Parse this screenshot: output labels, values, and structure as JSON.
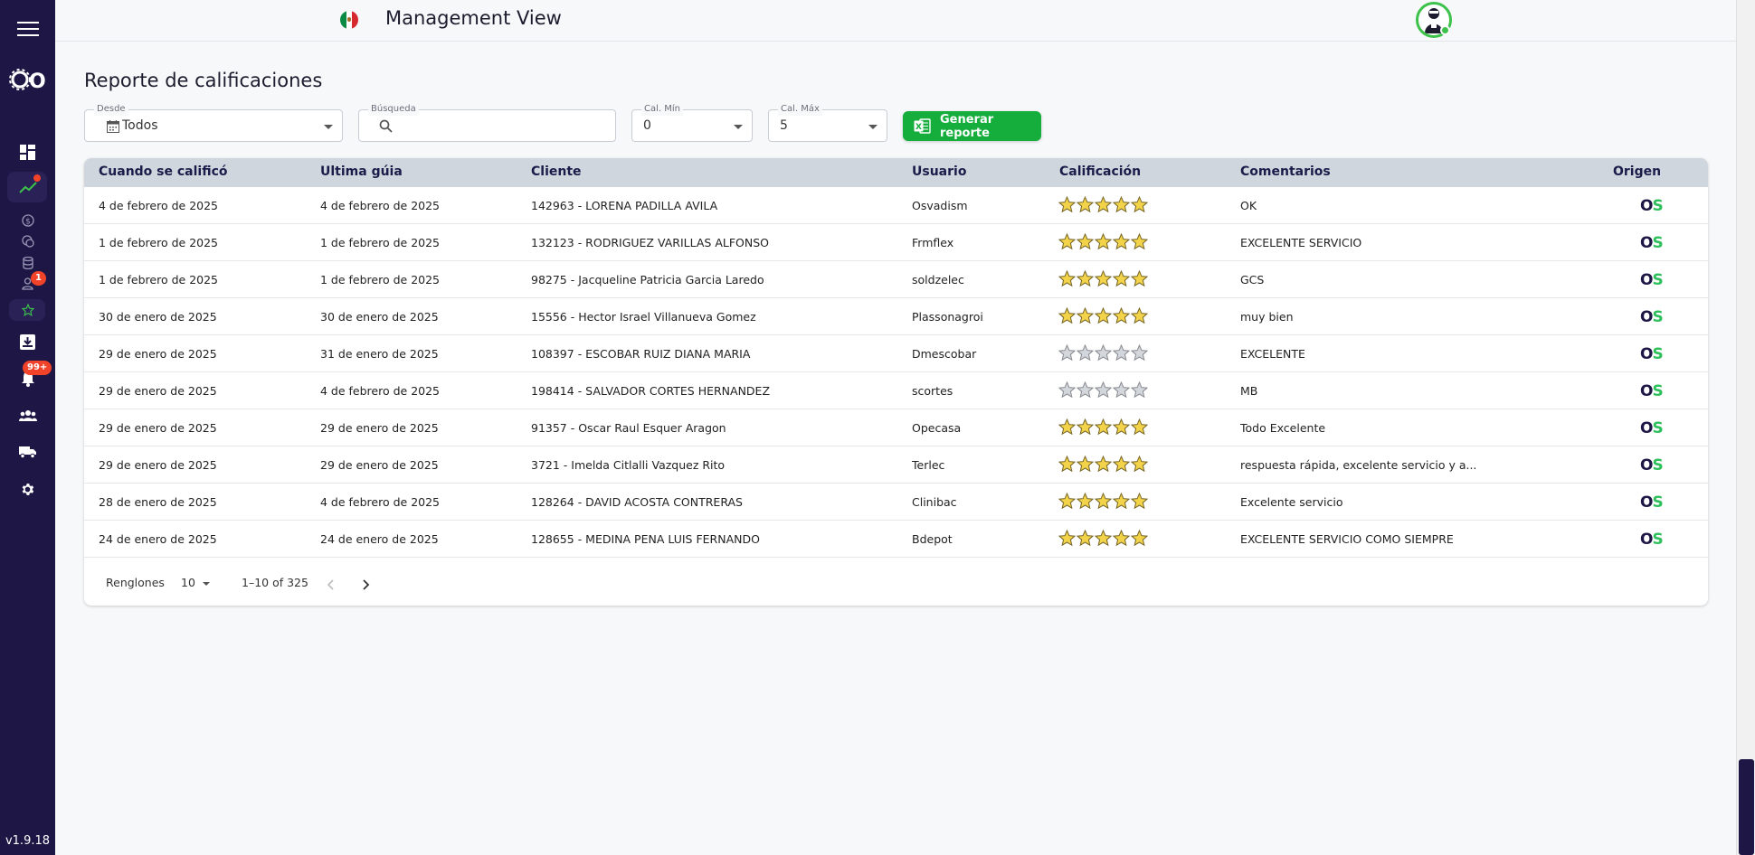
{
  "app": {
    "header_title": "Management View",
    "version": "v1.9.18",
    "logo_text": "OS",
    "flag": "mexico-flag",
    "sidebar": {
      "trend_badge": "dot",
      "user_badge": "1",
      "notif_badge": "99+"
    }
  },
  "page": {
    "title": "Reporte de calificaciones",
    "filters": {
      "desde_label": "Desde",
      "desde_value": "Todos",
      "busqueda_label": "Búsqueda",
      "busqueda_value": "",
      "calmin_label": "Cal. Mín",
      "calmin_value": "0",
      "calmax_label": "Cal. Máx",
      "calmax_value": "5"
    },
    "generate_button": "Generar reporte"
  },
  "table": {
    "headers": {
      "fecha": "Cuando se calificó",
      "guia": "Ultima gúia",
      "cliente": "Cliente",
      "usuario": "Usuario",
      "calificacion": "Calificación",
      "comentarios": "Comentarios",
      "origen": "Origen"
    },
    "rows": [
      {
        "fecha": "4 de febrero de 2025",
        "guia": "4 de febrero de 2025",
        "cliente": "142963 - LORENA PADILLA AVILA",
        "usuario": "Osvadism",
        "rating": 5,
        "comentario": "OK",
        "origen": "OS"
      },
      {
        "fecha": "1 de febrero de 2025",
        "guia": "1 de febrero de 2025",
        "cliente": "132123 - RODRIGUEZ VARILLAS ALFONSO",
        "usuario": "Frmflex",
        "rating": 5,
        "comentario": "EXCELENTE SERVICIO",
        "origen": "OS"
      },
      {
        "fecha": "1 de febrero de 2025",
        "guia": "1 de febrero de 2025",
        "cliente": "98275 - Jacqueline Patricia Garcia Laredo",
        "usuario": "soldzelec",
        "rating": 5,
        "comentario": "GCS",
        "origen": "OS"
      },
      {
        "fecha": "30 de enero de 2025",
        "guia": "30 de enero de 2025",
        "cliente": "15556 - Hector Israel Villanueva Gomez",
        "usuario": "Plassonagroi",
        "rating": 5,
        "comentario": "muy bien",
        "origen": "OS"
      },
      {
        "fecha": "29 de enero de 2025",
        "guia": "31 de enero de 2025",
        "cliente": "108397 - ESCOBAR RUIZ DIANA MARIA",
        "usuario": "Dmescobar",
        "rating": 0,
        "comentario": "EXCELENTE",
        "origen": "OS"
      },
      {
        "fecha": "29 de enero de 2025",
        "guia": "4 de febrero de 2025",
        "cliente": "198414 - SALVADOR CORTES HERNANDEZ",
        "usuario": "scortes",
        "rating": 0,
        "comentario": "MB",
        "origen": "OS"
      },
      {
        "fecha": "29 de enero de 2025",
        "guia": "29 de enero de 2025",
        "cliente": "91357 - Oscar Raul Esquer Aragon",
        "usuario": "Opecasa",
        "rating": 5,
        "comentario": "Todo Excelente",
        "origen": "OS"
      },
      {
        "fecha": "29 de enero de 2025",
        "guia": "29 de enero de 2025",
        "cliente": "3721 - Imelda Citlalli Vazquez Rito",
        "usuario": "Terlec",
        "rating": 5,
        "comentario": "respuesta rápida, excelente servicio y a...",
        "origen": "OS"
      },
      {
        "fecha": "28 de enero de 2025",
        "guia": "4 de febrero de 2025",
        "cliente": "128264 - DAVID ACOSTA CONTRERAS",
        "usuario": "Clinibac",
        "rating": 5,
        "comentario": "Excelente servicio",
        "origen": "OS"
      },
      {
        "fecha": "24 de enero de 2025",
        "guia": "24 de enero de 2025",
        "cliente": "128655 - MEDINA PENA LUIS FERNANDO",
        "usuario": "Bdepot",
        "rating": 5,
        "comentario": "EXCELENTE SERVICIO COMO SIEMPRE",
        "origen": "OS"
      }
    ],
    "footer": {
      "rows_label": "Renglones",
      "rows_value": "10",
      "range": "1–10 of 325"
    }
  },
  "colors": {
    "sidebar_bg": "#1e1645",
    "accent_green": "#15ad3c",
    "star_filled": "#f3d34a",
    "star_empty": "#d3d6db",
    "badge_red": "#f0432a"
  }
}
